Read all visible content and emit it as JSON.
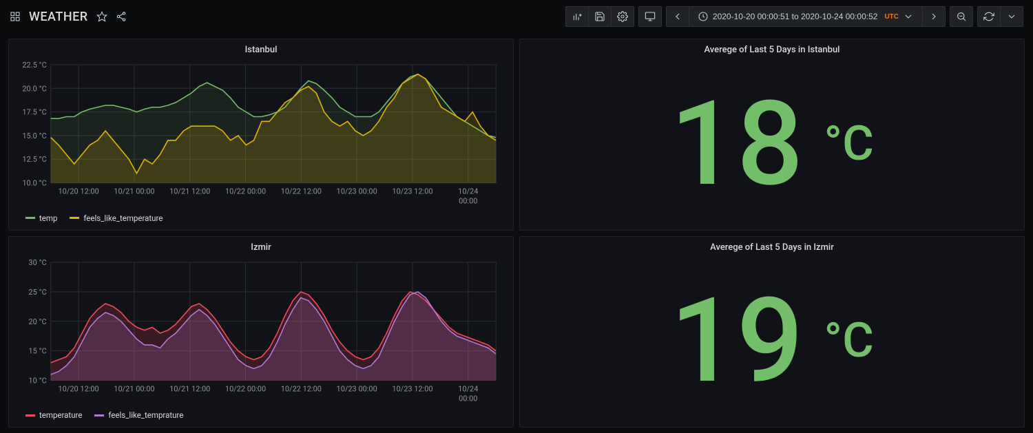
{
  "header": {
    "title": "WEATHER",
    "time_range": "2020-10-20 00:00:51 to 2020-10-24 00:00:52",
    "time_zone": "UTC"
  },
  "panels": {
    "istanbul_chart": {
      "title": "Istanbul"
    },
    "istanbul_stat": {
      "title": "Averege of Last 5 Days in Istanbul",
      "value": "18",
      "unit": "°C"
    },
    "izmir_chart": {
      "title": "Izmir"
    },
    "izmir_stat": {
      "title": "Averege of Last 5 Days in Izmir",
      "value": "19",
      "unit": "°C"
    }
  },
  "legends": {
    "istanbul": [
      {
        "name": "temp",
        "color": "#73bf69"
      },
      {
        "name": "feels_like_temperature",
        "color": "#e0b400"
      }
    ],
    "izmir": [
      {
        "name": "temperature",
        "color": "#f2495c"
      },
      {
        "name": "feels_like_temprature",
        "color": "#b877d9"
      }
    ]
  },
  "x_ticks": [
    "10/20 12:00",
    "10/21 00:00",
    "10/21 12:00",
    "10/22 00:00",
    "10/22 12:00",
    "10/23 00:00",
    "10/23 12:00",
    "10/24 00:00"
  ],
  "chart_data": [
    {
      "panel": "istanbul_chart",
      "type": "area",
      "title": "Istanbul",
      "xlabel": "",
      "ylabel": "",
      "ylim": [
        10,
        22.5
      ],
      "y_ticks": [
        10.0,
        12.5,
        15.0,
        17.5,
        20.0,
        22.5
      ],
      "y_tick_labels": [
        "10.0 °C",
        "12.5 °C",
        "15.0 °C",
        "17.5 °C",
        "20.0 °C",
        "22.5 °C"
      ],
      "x_tick_labels": [
        "10/20 12:00",
        "10/21 00:00",
        "10/21 12:00",
        "10/22 00:00",
        "10/22 12:00",
        "10/23 00:00",
        "10/23 12:00",
        "10/24 00:00"
      ],
      "series": [
        {
          "name": "temp",
          "color": "#73bf69",
          "fill": "rgba(115,191,105,0.10)",
          "values": [
            16.8,
            16.8,
            17.0,
            17.0,
            17.5,
            17.8,
            18.0,
            18.2,
            18.2,
            18.0,
            17.8,
            17.5,
            17.8,
            18.0,
            18.0,
            18.2,
            18.5,
            19.0,
            19.5,
            20.2,
            20.6,
            20.2,
            19.8,
            19.0,
            18.0,
            17.5,
            17.0,
            17.0,
            17.2,
            17.5,
            18.0,
            19.0,
            20.0,
            20.8,
            20.5,
            19.8,
            19.0,
            18.0,
            17.5,
            17.0,
            17.0,
            17.0,
            17.5,
            18.5,
            19.5,
            20.5,
            21.2,
            21.5,
            21.0,
            20.0,
            19.0,
            18.0,
            17.0,
            16.5,
            16.0,
            15.5,
            15.0,
            14.8
          ]
        },
        {
          "name": "feels_like_temperature",
          "color": "#e0b400",
          "fill": "rgba(224,180,0,0.18)",
          "values": [
            14.8,
            14.0,
            13.0,
            12.0,
            13.0,
            14.0,
            14.5,
            15.5,
            14.5,
            13.5,
            12.5,
            11.0,
            12.5,
            12.0,
            13.0,
            14.5,
            14.5,
            15.5,
            16.0,
            16.0,
            16.0,
            16.0,
            15.5,
            14.5,
            15.0,
            14.0,
            14.5,
            16.5,
            16.5,
            17.5,
            18.5,
            19.0,
            19.8,
            20.2,
            19.5,
            17.5,
            16.5,
            16.0,
            16.5,
            15.5,
            15.0,
            15.5,
            16.5,
            18.0,
            19.0,
            20.5,
            21.0,
            21.5,
            21.0,
            19.5,
            18.0,
            17.5,
            17.0,
            16.5,
            17.5,
            16.0,
            15.0,
            14.5
          ]
        }
      ]
    },
    {
      "panel": "izmir_chart",
      "type": "area",
      "title": "Izmir",
      "xlabel": "",
      "ylabel": "",
      "ylim": [
        10,
        30
      ],
      "y_ticks": [
        10,
        15,
        20,
        25,
        30
      ],
      "y_tick_labels": [
        "10 °C",
        "15 °C",
        "20 °C",
        "25 °C",
        "30 °C"
      ],
      "x_tick_labels": [
        "10/20 12:00",
        "10/21 00:00",
        "10/21 12:00",
        "10/22 00:00",
        "10/22 12:00",
        "10/23 00:00",
        "10/23 12:00",
        "10/24 00:00"
      ],
      "series": [
        {
          "name": "temperature",
          "color": "#f2495c",
          "fill": "rgba(242,73,92,0.18)",
          "values": [
            13.0,
            13.5,
            14.0,
            15.5,
            18.0,
            20.5,
            22.0,
            23.0,
            22.5,
            21.5,
            20.0,
            19.0,
            18.5,
            19.0,
            18.0,
            18.5,
            19.5,
            21.0,
            22.5,
            23.0,
            22.0,
            20.5,
            18.5,
            16.5,
            15.0,
            14.0,
            13.5,
            14.0,
            15.5,
            18.0,
            21.0,
            23.5,
            25.0,
            24.5,
            23.0,
            21.0,
            18.5,
            16.5,
            15.0,
            14.0,
            13.5,
            14.0,
            15.5,
            18.0,
            21.0,
            23.5,
            25.0,
            24.5,
            23.5,
            22.0,
            20.5,
            19.0,
            18.0,
            17.5,
            17.0,
            16.5,
            16.0,
            15.0
          ]
        },
        {
          "name": "feels_like_temprature",
          "color": "#b877d9",
          "fill": "rgba(184,119,217,0.20)",
          "values": [
            11.0,
            11.5,
            12.5,
            14.0,
            16.5,
            19.0,
            20.5,
            21.5,
            21.0,
            20.0,
            18.5,
            17.0,
            16.0,
            16.0,
            15.5,
            17.0,
            18.0,
            19.5,
            21.0,
            22.0,
            21.0,
            19.5,
            17.5,
            15.5,
            13.5,
            12.5,
            12.0,
            12.5,
            14.0,
            16.5,
            19.5,
            22.0,
            24.0,
            23.5,
            22.0,
            20.0,
            17.5,
            15.0,
            13.5,
            12.5,
            12.0,
            12.5,
            14.0,
            17.0,
            20.0,
            22.5,
            24.5,
            25.0,
            24.0,
            22.0,
            20.0,
            18.5,
            17.5,
            17.0,
            16.5,
            16.0,
            15.5,
            14.5
          ]
        }
      ]
    }
  ]
}
